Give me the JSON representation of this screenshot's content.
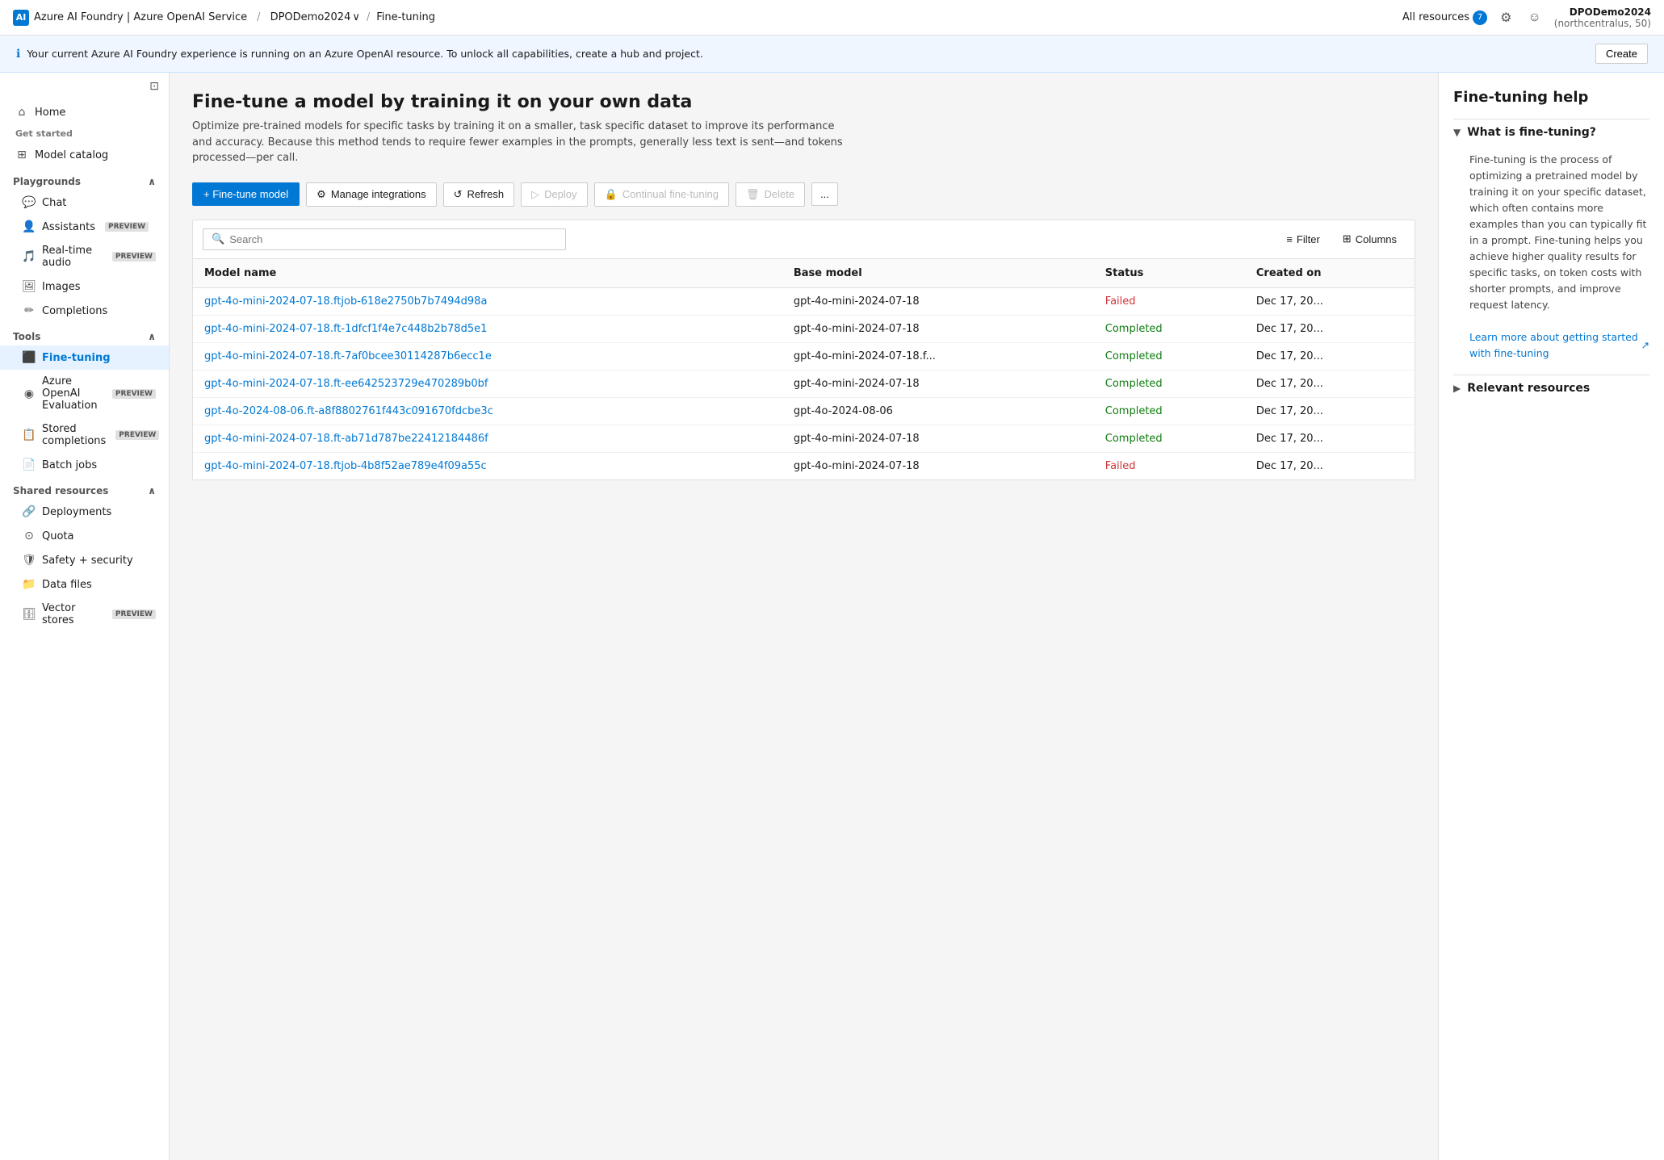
{
  "topbar": {
    "logo_text": "Azure AI Foundry | Azure OpenAI Service",
    "breadcrumb": [
      {
        "label": "DPODemo2024",
        "has_chevron": true
      },
      {
        "label": "Fine-tuning"
      }
    ],
    "resources_label": "All resources",
    "resources_count": "7",
    "user_name": "DPODemo2024",
    "user_sub": "(northcentralus, 50)"
  },
  "banner": {
    "text": "Your current Azure AI Foundry experience is running on an Azure OpenAI resource. To unlock all capabilities, create a hub and project.",
    "create_label": "Create"
  },
  "sidebar": {
    "home_label": "Home",
    "get_started_label": "Get started",
    "model_catalog_label": "Model catalog",
    "playgrounds_section_label": "Playgrounds",
    "chat_label": "Chat",
    "assistants_label": "Assistants",
    "assistants_preview": "PREVIEW",
    "realtime_audio_label": "Real-time audio",
    "realtime_preview": "PREVIEW",
    "images_label": "Images",
    "completions_label": "Completions",
    "tools_section_label": "Tools",
    "fine_tuning_label": "Fine-tuning",
    "azure_openai_label": "Azure OpenAI Evaluation",
    "azure_openai_preview": "PREVIEW",
    "stored_completions_label": "Stored completions",
    "stored_completions_preview": "PREVIEW",
    "batch_jobs_label": "Batch jobs",
    "shared_resources_label": "Shared resources",
    "deployments_label": "Deployments",
    "quota_label": "Quota",
    "safety_label": "Safety + security",
    "data_files_label": "Data files",
    "vector_stores_label": "Vector stores",
    "vector_stores_preview": "PREVIEW"
  },
  "page": {
    "title": "Fine-tune a model by training it on your own data",
    "subtitle": "Optimize pre-trained models for specific tasks by training it on a smaller, task specific dataset to improve its performance and accuracy. Because this method tends to require fewer examples in the prompts, generally less text is sent—and tokens processed—per call.",
    "btn_fine_tune": "+ Fine-tune model",
    "btn_manage_integrations": "Manage integrations",
    "btn_refresh": "Refresh",
    "btn_deploy": "Deploy",
    "btn_continual_fine_tuning": "Continual fine-tuning",
    "btn_delete": "Delete",
    "btn_more": "...",
    "search_placeholder": "Search",
    "filter_label": "Filter",
    "columns_label": "Columns",
    "table": {
      "headers": [
        "Model name",
        "Base model",
        "Status",
        "Created on"
      ],
      "rows": [
        {
          "model_name": "gpt-4o-mini-2024-07-18.ftjob-618e2750b7b7494d98a",
          "base_model": "gpt-4o-mini-2024-07-18",
          "status": "Failed",
          "created_on": "Dec 17, 20..."
        },
        {
          "model_name": "gpt-4o-mini-2024-07-18.ft-1dfcf1f4e7c448b2b78d5e1",
          "base_model": "gpt-4o-mini-2024-07-18",
          "status": "Completed",
          "created_on": "Dec 17, 20..."
        },
        {
          "model_name": "gpt-4o-mini-2024-07-18.ft-7af0bcee30114287b6ecc1e",
          "base_model": "gpt-4o-mini-2024-07-18.f...",
          "status": "Completed",
          "created_on": "Dec 17, 20..."
        },
        {
          "model_name": "gpt-4o-mini-2024-07-18.ft-ee642523729e470289b0bf",
          "base_model": "gpt-4o-mini-2024-07-18",
          "status": "Completed",
          "created_on": "Dec 17, 20..."
        },
        {
          "model_name": "gpt-4o-2024-08-06.ft-a8f8802761f443c091670fdcbe3c",
          "base_model": "gpt-4o-2024-08-06",
          "status": "Completed",
          "created_on": "Dec 17, 20..."
        },
        {
          "model_name": "gpt-4o-mini-2024-07-18.ft-ab71d787be22412184486f",
          "base_model": "gpt-4o-mini-2024-07-18",
          "status": "Completed",
          "created_on": "Dec 17, 20..."
        },
        {
          "model_name": "gpt-4o-mini-2024-07-18.ftjob-4b8f52ae789e4f09a55c",
          "base_model": "gpt-4o-mini-2024-07-18",
          "status": "Failed",
          "created_on": "Dec 17, 20..."
        }
      ]
    }
  },
  "right_panel": {
    "title": "Fine-tuning help",
    "sections": [
      {
        "label": "What is fine-tuning?",
        "expanded": true,
        "content": "Fine-tuning is the process of optimizing a pretrained model by training it on your specific dataset, which often contains more examples than you can typically fit in a prompt. Fine-tuning helps you achieve higher quality results for specific tasks, on token costs with shorter prompts, and improve request latency.",
        "link_text": "Learn more about getting started with fine-tuning",
        "link_icon": "↗"
      },
      {
        "label": "Relevant resources",
        "expanded": false,
        "content": ""
      }
    ]
  }
}
